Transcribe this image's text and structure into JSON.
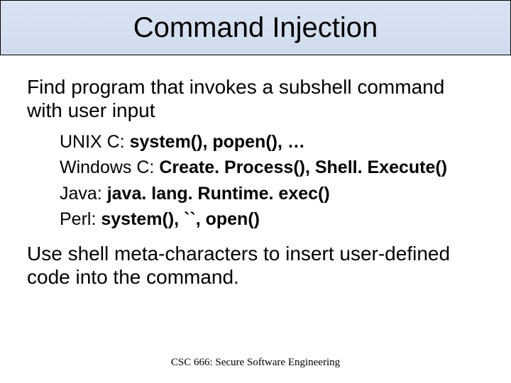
{
  "title": "Command Injection",
  "main1": "Find program that invokes a subshell command with user input",
  "sub": {
    "unix_prefix": "UNIX C: ",
    "unix_calls": "system(), popen(), …",
    "win_prefix": "Windows C: ",
    "win_calls": "Create. Process(), Shell. Execute()",
    "java_prefix": "Java: ",
    "java_calls": "java. lang. Runtime. exec()",
    "perl_prefix": "Perl: ",
    "perl_calls": "system(), ``, open()"
  },
  "main2": "Use shell meta-characters to insert user-defined code into the command.",
  "footer": "CSC 666: Secure Software Engineering"
}
